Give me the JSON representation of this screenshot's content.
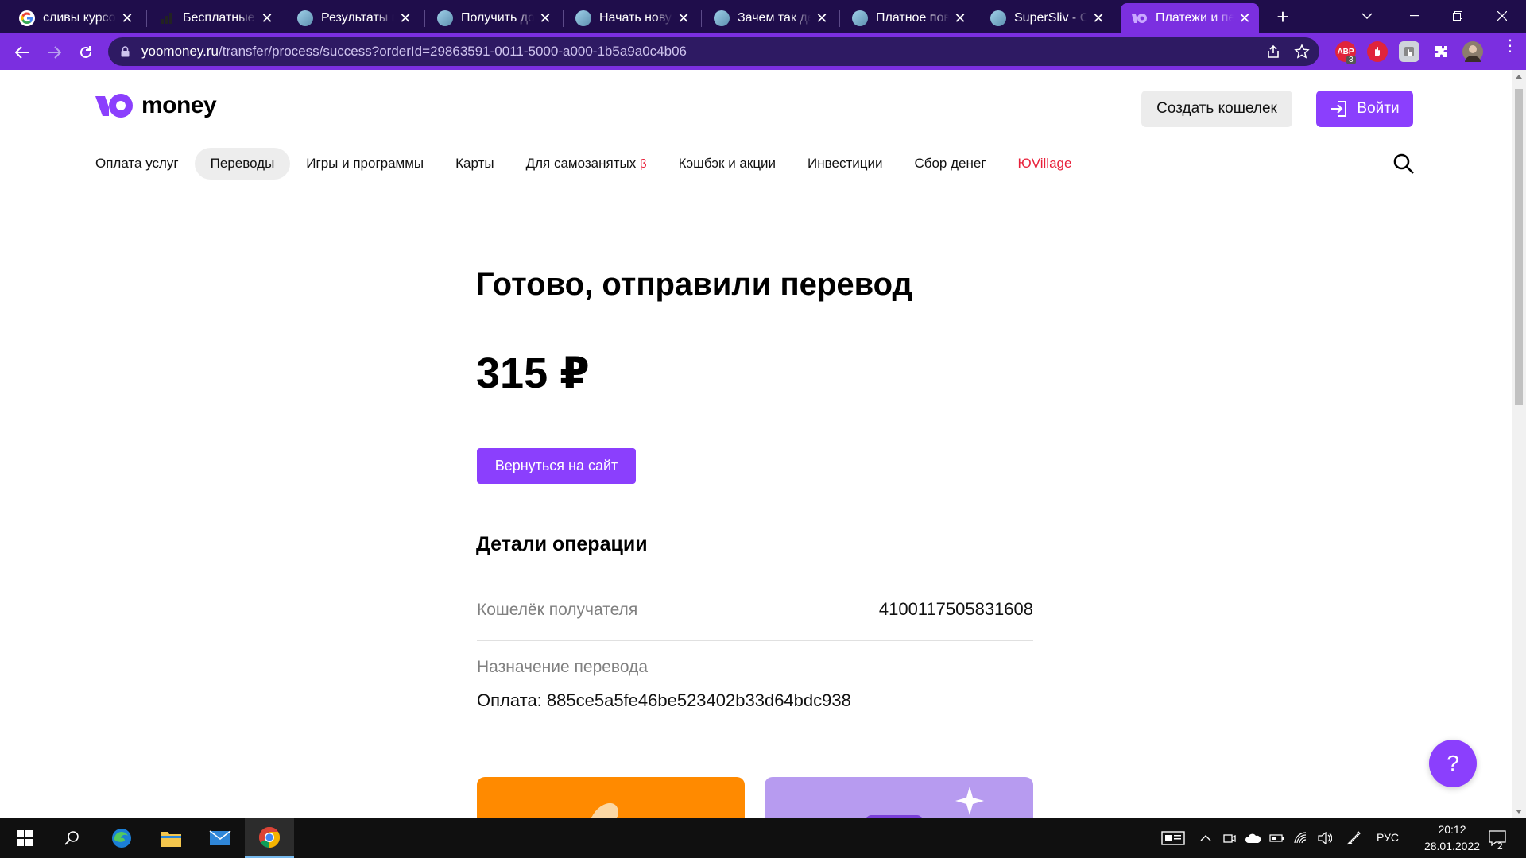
{
  "browser": {
    "tabs": [
      {
        "title": "сливы курсов",
        "favicon": "google-icon",
        "active": false
      },
      {
        "title": "Бесплатные к",
        "favicon": "bars-icon",
        "active": false
      },
      {
        "title": "Результаты п",
        "favicon": "site-icon",
        "active": false
      },
      {
        "title": "Получить дос",
        "favicon": "site-icon",
        "active": false
      },
      {
        "title": "Начать новую",
        "favicon": "site-icon",
        "active": false
      },
      {
        "title": "Зачем так дел",
        "favicon": "site-icon",
        "active": false
      },
      {
        "title": "Платное повы",
        "favicon": "site-icon",
        "active": false
      },
      {
        "title": "SuperSliv - Сл",
        "favicon": "site-icon",
        "active": false
      },
      {
        "title": "Платежи и пе",
        "favicon": "yoomoney-icon",
        "active": true
      }
    ],
    "url_host": "yoomoney.ru",
    "url_path": "/transfer/process/success?orderId=29863591-0011-5000-a000-1b5a9a0c4b06",
    "ext_badge_count": "3",
    "ext_abp_label": "ABP"
  },
  "header": {
    "logo_text": "money",
    "create_wallet_label": "Создать кошелек",
    "login_label": "Войти"
  },
  "nav": {
    "items": [
      {
        "label": "Оплата услуг"
      },
      {
        "label": "Переводы",
        "current": true
      },
      {
        "label": "Игры и программы"
      },
      {
        "label": "Карты"
      },
      {
        "label": "Для самозанятых",
        "badge": "β"
      },
      {
        "label": "Кэшбэк и акции"
      },
      {
        "label": "Инвестиции"
      },
      {
        "label": "Сбор денег"
      },
      {
        "label": "ЮVillage",
        "highlight": true
      }
    ]
  },
  "main": {
    "title": "Готово, отправили перевод",
    "amount": "315 ₽",
    "back_button_label": "Вернуться на сайт",
    "details_title": "Детали операции",
    "details": {
      "wallet_label": "Кошелёк получателя",
      "wallet_value": "4100117505831608",
      "purpose_label": "Назначение перевода",
      "purpose_value": "Оплата: 885ce5a5fe46be523402b33d64bdc938"
    },
    "help_label": "?"
  },
  "taskbar": {
    "lang": "РУС",
    "time": "20:12",
    "date": "28.01.2022",
    "notifications": "2"
  },
  "colors": {
    "brand_purple": "#8b3ffd",
    "chrome_frame": "#1f0d4b",
    "chrome_toolbar": "#7b2fe0",
    "accent_red": "#e8203a",
    "promo_orange": "#ff8a00",
    "promo_purple": "#b79bf0"
  }
}
